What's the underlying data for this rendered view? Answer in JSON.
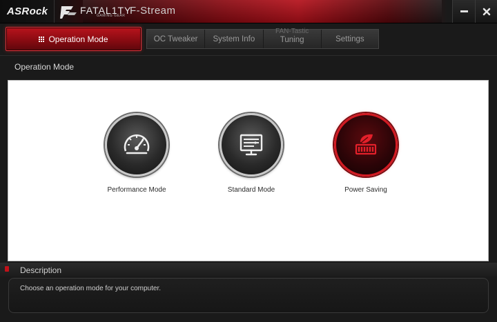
{
  "titlebar": {
    "brand": "ASRock",
    "fatality": "FATAL1TY",
    "gaming_gear": "GAMING GEAR",
    "app_name": "F-Stream"
  },
  "nav": {
    "active": "Operation Mode",
    "tabs": [
      {
        "label": "OC Tweaker"
      },
      {
        "label": "System Info"
      },
      {
        "label_line1": "FAN-Tastic",
        "label_line2": "Tuning"
      },
      {
        "label": "Settings"
      }
    ]
  },
  "section_title": "Operation Mode",
  "modes": [
    {
      "label": "Performance Mode",
      "icon": "speedometer-icon",
      "selected": false
    },
    {
      "label": "Standard Mode",
      "icon": "monitor-icon",
      "selected": false
    },
    {
      "label": "Power Saving",
      "icon": "leaf-battery-icon",
      "selected": true
    }
  ],
  "description": {
    "title": "Description",
    "text": "Choose an operation mode for your computer."
  },
  "colors": {
    "accent": "#b5101a",
    "background": "#1a1a1a",
    "panel": "#ffffff"
  }
}
